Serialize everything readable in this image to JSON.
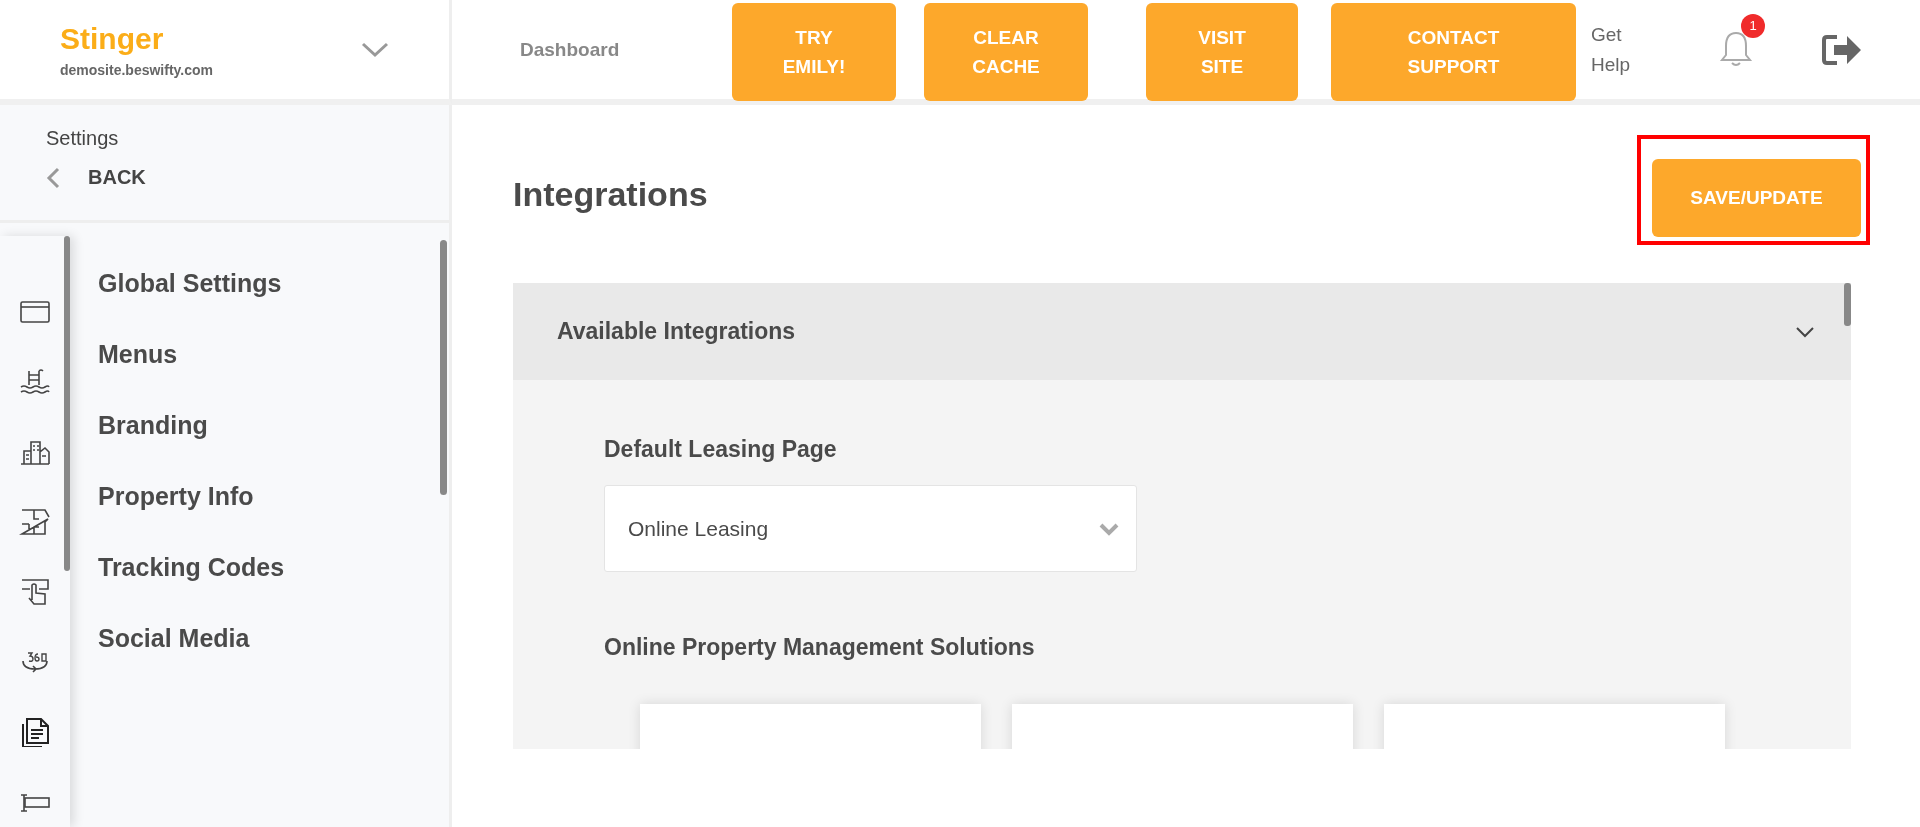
{
  "brand": {
    "name": "Stinger",
    "site": "demosite.beswifty.com"
  },
  "topnav": {
    "dashboard": "Dashboard",
    "buttons": [
      "TRY\nEMILY!",
      "CLEAR\nCACHE",
      "VISIT\nSITE",
      "CONTACT\nSUPPORT"
    ],
    "help": "Get\nHelp",
    "notification_count": "1"
  },
  "sidebar": {
    "title": "Settings",
    "back": "BACK",
    "items": [
      {
        "label": "Global Settings"
      },
      {
        "label": "Menus"
      },
      {
        "label": "Branding"
      },
      {
        "label": "Property Info"
      },
      {
        "label": "Tracking Codes"
      },
      {
        "label": "Social Media"
      }
    ]
  },
  "main": {
    "title": "Integrations",
    "save_button": "SAVE/UPDATE",
    "panel": {
      "title": "Available Integrations",
      "expanded": true,
      "field": {
        "label": "Default Leasing Page",
        "value": "Online Leasing"
      },
      "section": "Online Property Management Solutions"
    }
  }
}
